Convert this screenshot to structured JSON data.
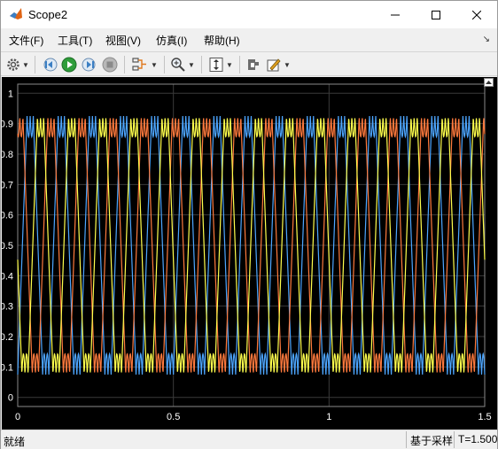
{
  "window": {
    "title": "Scope2",
    "icon": "matlab-logo-icon"
  },
  "menu": [
    {
      "label": "文件(F)"
    },
    {
      "label": "工具(T)"
    },
    {
      "label": "视图(V)"
    },
    {
      "label": "仿真(I)"
    },
    {
      "label": "帮助(H)"
    }
  ],
  "toolbar": {
    "icons": [
      "gear-icon",
      "step-back-icon",
      "run-icon",
      "step-forward-icon",
      "stop-icon",
      "signal-selector-icon",
      "zoom-icon",
      "autoscale-icon",
      "highlight-icon",
      "style-icon"
    ]
  },
  "chart_data": {
    "type": "line",
    "xlim": [
      0,
      1.5
    ],
    "ylim": [
      -0.03,
      1.03
    ],
    "x_ticks": [
      "0",
      "0.5",
      "1",
      "1.5"
    ],
    "y_ticks": [
      "0",
      "0.1",
      "0.2",
      "0.3",
      "0.4",
      "0.5",
      "0.6",
      "0.7",
      "0.8",
      "0.9",
      "1"
    ],
    "grid": true,
    "background": "#000000",
    "grid_color": "#3a3a3a",
    "tick_color": "#ffffff",
    "series": [
      {
        "color": "#4da6ff",
        "phase": 0.0
      },
      {
        "color": "#ff7a3d",
        "phase": 0.3333
      },
      {
        "color": "#ffff4d",
        "phase": 0.6667
      }
    ],
    "frequency": 10,
    "signal_min": 0.075,
    "signal_max": 0.925
  },
  "status": {
    "ready": "就绪",
    "mode": "基于采样",
    "time": "T=1.500"
  }
}
